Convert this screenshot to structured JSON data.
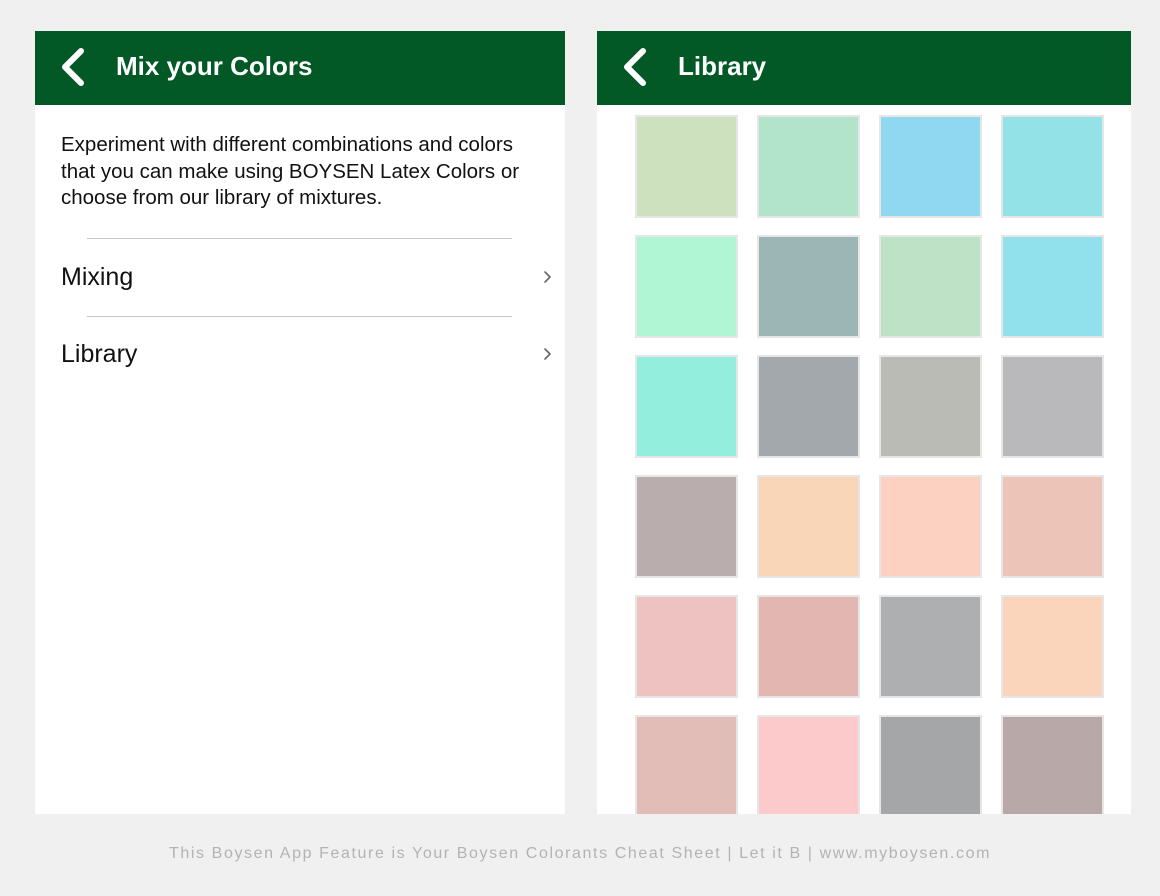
{
  "mix_screen": {
    "title": "Mix your Colors",
    "description": "Experiment with different combinations and colors that you can make using BOYSEN Latex Colors or choose from our library of mixtures.",
    "menu": [
      {
        "label": "Mixing"
      },
      {
        "label": "Library"
      }
    ],
    "chevron_glyph": "›"
  },
  "library_screen": {
    "title": "Library",
    "swatches": [
      "#cde1bf",
      "#b1e4cb",
      "#90d8f1",
      "#92e2e7",
      "#b0f6d5",
      "#9bb6b5",
      "#bde2c5",
      "#90e1eb",
      "#93eedd",
      "#a3a8ad",
      "#bbbbb5",
      "#b9b8bb",
      "#b9adae",
      "#f8d6b7",
      "#fcd1c1",
      "#ecc5b8",
      "#eec2c1",
      "#e3b6b2",
      "#aeafb1",
      "#fbd5bb",
      "#e2bdb7",
      "#fdcacb",
      "#a5a6a8",
      "#b8a9a8"
    ]
  },
  "theme": {
    "header_color": "#025925",
    "background": "#f0f0f0"
  },
  "icons": {
    "back": "chevron-left-icon",
    "menu_arrow": "chevron-right-icon"
  },
  "caption": "This Boysen App Feature is Your Boysen Colorants Cheat Sheet | Let it B | www.myboysen.com"
}
